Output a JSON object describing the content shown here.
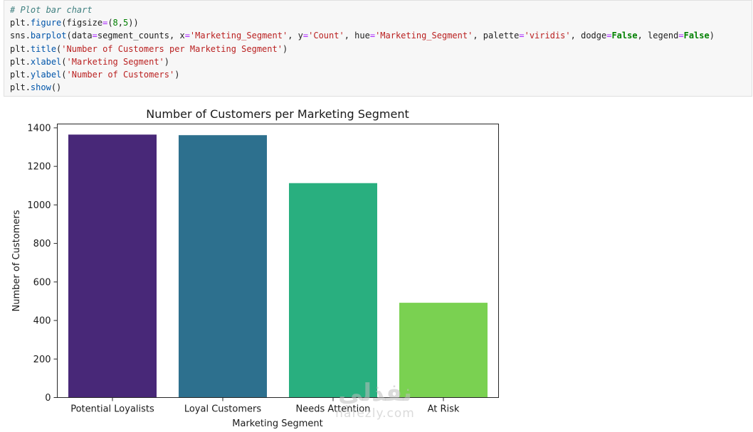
{
  "code_cell": {
    "lines": [
      [
        {
          "t": "# Plot bar chart",
          "c": "c"
        }
      ],
      [
        {
          "t": "plt",
          "c": ""
        },
        {
          "t": ".",
          "c": ""
        },
        {
          "t": "figure",
          "c": "f"
        },
        {
          "t": "(figsize",
          "c": ""
        },
        {
          "t": "=",
          "c": "o"
        },
        {
          "t": "(",
          "c": ""
        },
        {
          "t": "8",
          "c": "n"
        },
        {
          "t": ",",
          "c": ""
        },
        {
          "t": "5",
          "c": "n"
        },
        {
          "t": "))",
          "c": ""
        }
      ],
      [
        {
          "t": "sns",
          "c": ""
        },
        {
          "t": ".",
          "c": ""
        },
        {
          "t": "barplot",
          "c": "f"
        },
        {
          "t": "(data",
          "c": ""
        },
        {
          "t": "=",
          "c": "o"
        },
        {
          "t": "segment_counts, x",
          "c": ""
        },
        {
          "t": "=",
          "c": "o"
        },
        {
          "t": "'Marketing_Segment'",
          "c": "s"
        },
        {
          "t": ", y",
          "c": ""
        },
        {
          "t": "=",
          "c": "o"
        },
        {
          "t": "'Count'",
          "c": "s"
        },
        {
          "t": ", hue",
          "c": ""
        },
        {
          "t": "=",
          "c": "o"
        },
        {
          "t": "'Marketing_Segment'",
          "c": "s"
        },
        {
          "t": ", palette",
          "c": ""
        },
        {
          "t": "=",
          "c": "o"
        },
        {
          "t": "'viridis'",
          "c": "s"
        },
        {
          "t": ", dodge",
          "c": ""
        },
        {
          "t": "=",
          "c": "o"
        },
        {
          "t": "False",
          "c": "k"
        },
        {
          "t": ", legend",
          "c": ""
        },
        {
          "t": "=",
          "c": "o"
        },
        {
          "t": "False",
          "c": "k"
        },
        {
          "t": ")",
          "c": ""
        }
      ],
      [
        {
          "t": "plt",
          "c": ""
        },
        {
          "t": ".",
          "c": ""
        },
        {
          "t": "title",
          "c": "f"
        },
        {
          "t": "(",
          "c": ""
        },
        {
          "t": "'Number of Customers per Marketing Segment'",
          "c": "s"
        },
        {
          "t": ")",
          "c": ""
        }
      ],
      [
        {
          "t": "plt",
          "c": ""
        },
        {
          "t": ".",
          "c": ""
        },
        {
          "t": "xlabel",
          "c": "f"
        },
        {
          "t": "(",
          "c": ""
        },
        {
          "t": "'Marketing Segment'",
          "c": "s"
        },
        {
          "t": ")",
          "c": ""
        }
      ],
      [
        {
          "t": "plt",
          "c": ""
        },
        {
          "t": ".",
          "c": ""
        },
        {
          "t": "ylabel",
          "c": "f"
        },
        {
          "t": "(",
          "c": ""
        },
        {
          "t": "'Number of Customers'",
          "c": "s"
        },
        {
          "t": ")",
          "c": ""
        }
      ],
      [
        {
          "t": "plt",
          "c": ""
        },
        {
          "t": ".",
          "c": ""
        },
        {
          "t": "show",
          "c": "f"
        },
        {
          "t": "()",
          "c": ""
        }
      ]
    ]
  },
  "chart_data": {
    "type": "bar",
    "title": "Number of Customers per Marketing Segment",
    "xlabel": "Marketing Segment",
    "ylabel": "Number of Customers",
    "categories": [
      "Potential Loyalists",
      "Loyal Customers",
      "Needs Attention",
      "At Risk"
    ],
    "values": [
      1365,
      1362,
      1113,
      492
    ],
    "colors": [
      "#482878",
      "#2d708e",
      "#29af7f",
      "#7ad151"
    ],
    "ylim": [
      0,
      1420
    ],
    "yticks": [
      0,
      200,
      400,
      600,
      800,
      1000,
      1200,
      1400
    ],
    "grid": false,
    "legend": false
  },
  "watermark": {
    "arabic": "نفذلي",
    "latin": "nafezly.com"
  }
}
